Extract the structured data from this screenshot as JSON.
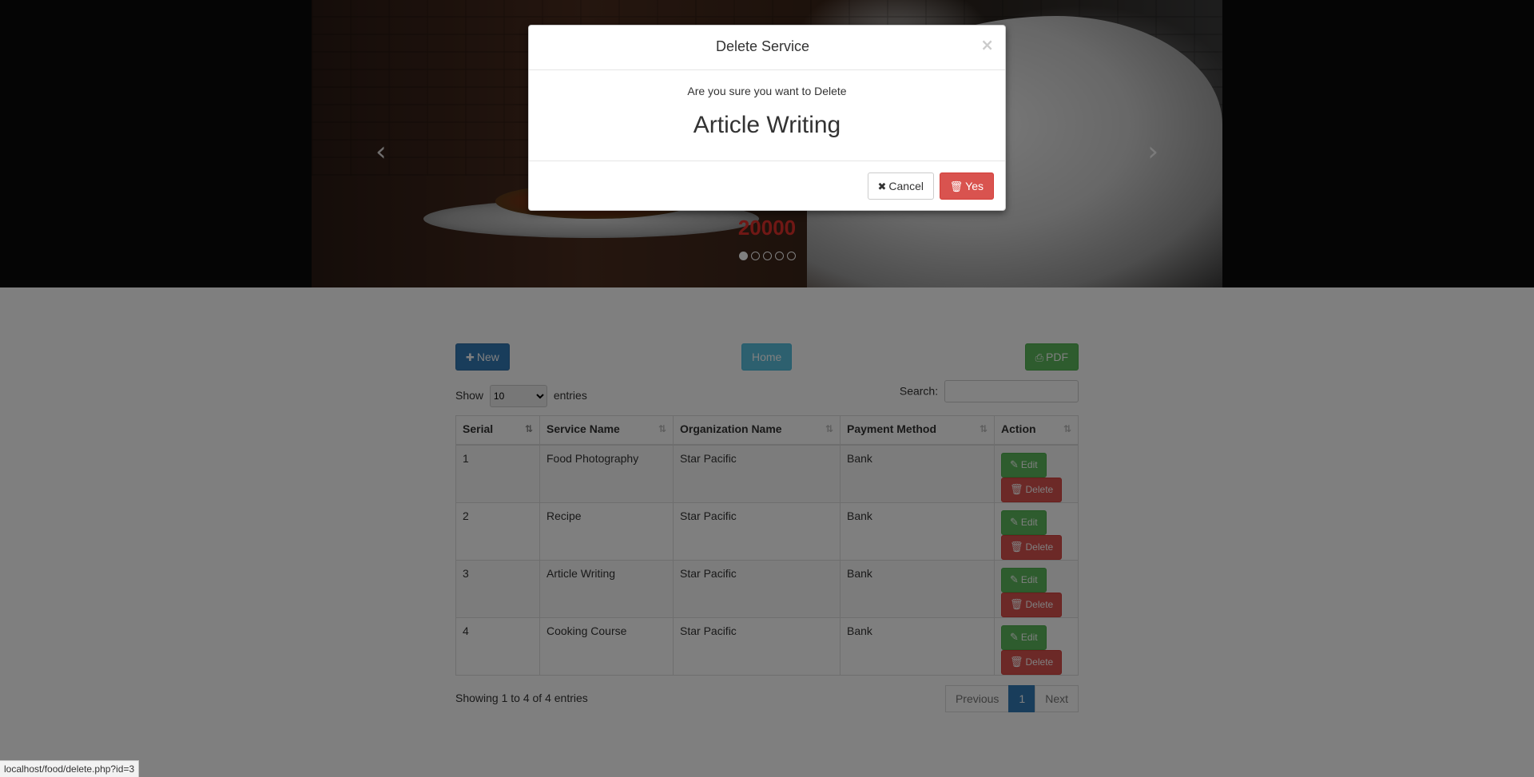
{
  "carousel": {
    "prev_glyph": "‹",
    "next_glyph": "›",
    "price": "20000",
    "slide_count": 5,
    "active_slide": 1
  },
  "toolbar": {
    "new_label": "New",
    "home_label": "Home",
    "pdf_label": "PDF"
  },
  "datatable": {
    "show_label": "Show",
    "entries_label": "entries",
    "page_length": "10",
    "search_label": "Search:",
    "search_value": "",
    "columns": [
      "Serial",
      "Service Name",
      "Organization Name",
      "Payment Method",
      "Action"
    ],
    "rows": [
      {
        "serial": "1",
        "service": "Food Photography",
        "organization": "Star Pacific",
        "payment": "Bank"
      },
      {
        "serial": "2",
        "service": "Recipe",
        "organization": "Star Pacific",
        "payment": "Bank"
      },
      {
        "serial": "3",
        "service": "Article Writing",
        "organization": "Star Pacific",
        "payment": "Bank"
      },
      {
        "serial": "4",
        "service": "Cooking Course",
        "organization": "Star Pacific",
        "payment": "Bank"
      }
    ],
    "edit_label": "Edit",
    "delete_label": "Delete",
    "info": "Showing 1 to 4 of 4 entries",
    "pagination": {
      "previous": "Previous",
      "current": "1",
      "next": "Next"
    }
  },
  "modal": {
    "title": "Delete Service",
    "close_glyph": "×",
    "question": "Are you sure you want to Delete",
    "item_name": "Article Writing",
    "cancel_label": "Cancel",
    "yes_label": "Yes"
  },
  "statusbar": {
    "url": "localhost/food/delete.php?id=3"
  },
  "colors": {
    "primary": "#337ab7",
    "info": "#5bc0de",
    "success": "#5cb85c",
    "danger": "#d9534f",
    "price": "#e0302a"
  },
  "icons": {
    "new": "plus-icon",
    "pdf": "print-icon",
    "edit": "edit-icon",
    "delete": "trash-icon",
    "cancel": "close-icon",
    "yes": "trash-icon"
  }
}
